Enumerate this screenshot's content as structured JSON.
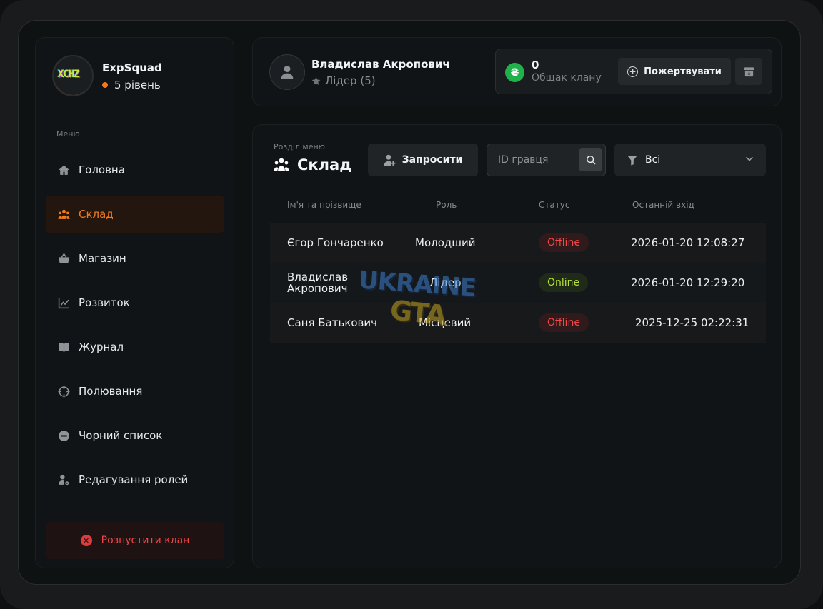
{
  "clan": {
    "name": "ExpSquad",
    "level": "5 рівень",
    "logo_text": "XCHZ"
  },
  "menu": {
    "caption": "Меню",
    "items": [
      {
        "label": "Головна",
        "icon": "home-icon"
      },
      {
        "label": "Склад",
        "icon": "members-icon",
        "active": true
      },
      {
        "label": "Магазин",
        "icon": "basket-icon"
      },
      {
        "label": "Розвиток",
        "icon": "chart-line-icon"
      },
      {
        "label": "Журнал",
        "icon": "book-icon"
      },
      {
        "label": "Полювання",
        "icon": "crosshair-icon"
      },
      {
        "label": "Чорний список",
        "icon": "block-icon"
      },
      {
        "label": "Редагування ролей",
        "icon": "user-gear-icon"
      }
    ],
    "disband_label": "Розпустити клан"
  },
  "user": {
    "name": "Владислав Акропович",
    "role": "Лідер (5)"
  },
  "bank": {
    "amount": "0",
    "label": "Общак клану",
    "currency_symbol": "₴",
    "donate_label": "Пожертвувати"
  },
  "section": {
    "caption": "Розділ меню",
    "title": "Склад"
  },
  "toolbar": {
    "invite_label": "Запросити",
    "search_placeholder": "ID гравця",
    "filter_value": "Всі"
  },
  "table": {
    "headers": [
      "Ім'я та прізвище",
      "Роль",
      "Статус",
      "Останній вхід"
    ],
    "rows": [
      {
        "name": "Єгор Гончаренко",
        "role": "Молодший",
        "status": "Offline",
        "last_login": "2026-01-20 12:08:27"
      },
      {
        "name": "Владислав Акропович",
        "role": "Лідер",
        "status": "Online",
        "last_login": "2026-01-20 12:29:20"
      },
      {
        "name": "Саня Батькович",
        "role": "Місцевий",
        "status": "Offline",
        "last_login": "2025-12-25 02:22:31"
      }
    ]
  },
  "watermark": {
    "line1": "UKRAINE",
    "line2": "GTA"
  },
  "colors": {
    "accent": "#f07a20",
    "danger": "#ee4646",
    "online": "#b8e03a",
    "coin": "#20b24a"
  }
}
